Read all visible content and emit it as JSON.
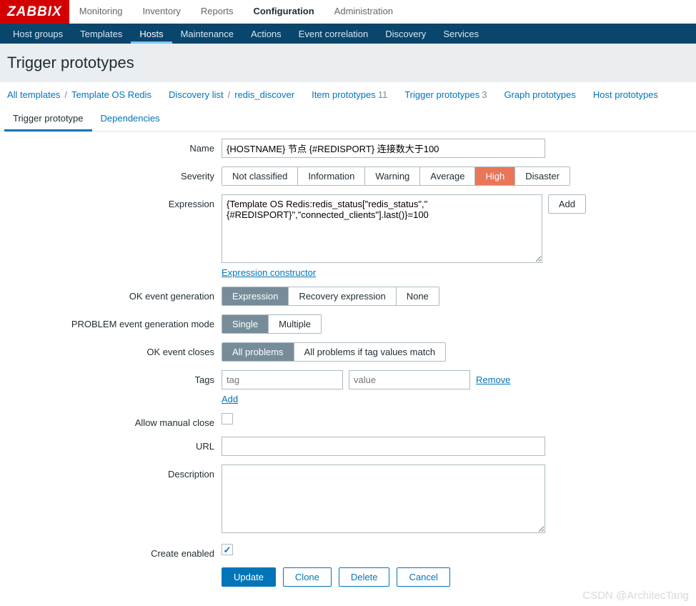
{
  "logo": "ZABBIX",
  "topnav": [
    "Monitoring",
    "Inventory",
    "Reports",
    "Configuration",
    "Administration"
  ],
  "topnav_active": 3,
  "subnav": [
    "Host groups",
    "Templates",
    "Hosts",
    "Maintenance",
    "Actions",
    "Event correlation",
    "Discovery",
    "Services"
  ],
  "subnav_active": 2,
  "page_title": "Trigger prototypes",
  "breadcrumbs": {
    "g1": [
      "All templates",
      "Template OS Redis"
    ],
    "g2": [
      "Discovery list",
      "redis_discover"
    ],
    "g3": [
      {
        "label": "Item prototypes",
        "count": "11"
      },
      {
        "label": "Trigger prototypes",
        "count": "3"
      },
      {
        "label": "Graph prototypes",
        "count": ""
      },
      {
        "label": "Host prototypes",
        "count": ""
      }
    ]
  },
  "tabs": [
    "Trigger prototype",
    "Dependencies"
  ],
  "tabs_active": 0,
  "form": {
    "name_label": "Name",
    "name_value": "{HOSTNAME} 节点 {#REDISPORT} 连接数大于100",
    "severity_label": "Severity",
    "severity_options": [
      "Not classified",
      "Information",
      "Warning",
      "Average",
      "High",
      "Disaster"
    ],
    "severity_selected": 4,
    "expression_label": "Expression",
    "expression_value": "{Template OS Redis:redis_status[\"redis_status\",\"{#REDISPORT}\",\"connected_clients\"].last()}=100",
    "expression_add": "Add",
    "expression_constructor": "Expression constructor",
    "ok_event_label": "OK event generation",
    "ok_event_options": [
      "Expression",
      "Recovery expression",
      "None"
    ],
    "ok_event_selected": 0,
    "problem_mode_label": "PROBLEM event generation mode",
    "problem_mode_options": [
      "Single",
      "Multiple"
    ],
    "problem_mode_selected": 0,
    "ok_closes_label": "OK event closes",
    "ok_closes_options": [
      "All problems",
      "All problems if tag values match"
    ],
    "ok_closes_selected": 0,
    "tags_label": "Tags",
    "tags_placeholder_tag": "tag",
    "tags_placeholder_value": "value",
    "tags_remove": "Remove",
    "tags_add": "Add",
    "allow_manual_label": "Allow manual close",
    "allow_manual_checked": false,
    "url_label": "URL",
    "url_value": "",
    "description_label": "Description",
    "description_value": "",
    "create_enabled_label": "Create enabled",
    "create_enabled_checked": true,
    "actions": {
      "update": "Update",
      "clone": "Clone",
      "delete": "Delete",
      "cancel": "Cancel"
    }
  },
  "watermark": "CSDN @ArchitecTang"
}
